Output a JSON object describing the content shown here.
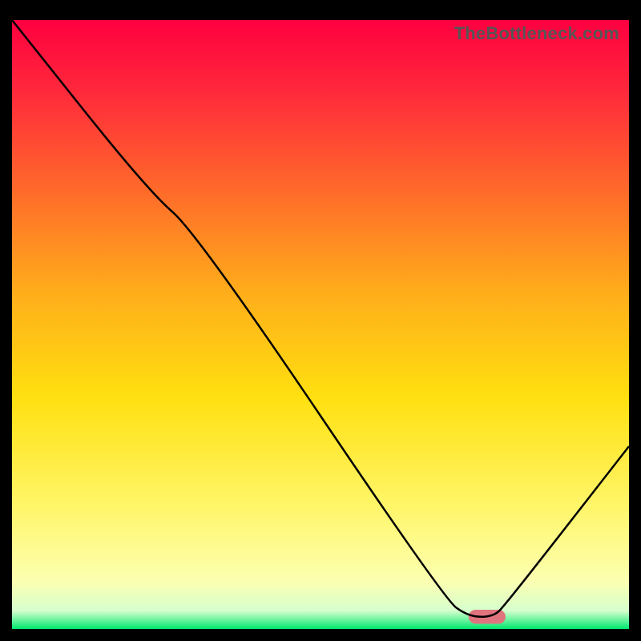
{
  "watermark": "TheBottleneck.com",
  "chart_data": {
    "type": "line",
    "title": "",
    "xlabel": "",
    "ylabel": "",
    "xlim": [
      0,
      100
    ],
    "ylim": [
      0,
      100
    ],
    "grid": false,
    "legend": false,
    "gradient_stops": [
      {
        "offset": 0.0,
        "color": "#ff0040"
      },
      {
        "offset": 0.12,
        "color": "#ff2a3b"
      },
      {
        "offset": 0.28,
        "color": "#ff6a2a"
      },
      {
        "offset": 0.45,
        "color": "#ffae1a"
      },
      {
        "offset": 0.62,
        "color": "#ffe010"
      },
      {
        "offset": 0.8,
        "color": "#fff66a"
      },
      {
        "offset": 0.92,
        "color": "#fcffb0"
      },
      {
        "offset": 0.97,
        "color": "#d6ffcd"
      },
      {
        "offset": 1.0,
        "color": "#00e86f"
      }
    ],
    "series": [
      {
        "name": "curve",
        "color": "#000000",
        "x": [
          0,
          22,
          30,
          70,
          74,
          78,
          80,
          100
        ],
        "y": [
          100,
          72,
          65,
          5,
          2,
          2,
          4,
          30
        ]
      }
    ],
    "marker": {
      "x_start": 74,
      "x_end": 80,
      "y": 2,
      "color": "#e0747e",
      "thickness": 2.3
    }
  }
}
